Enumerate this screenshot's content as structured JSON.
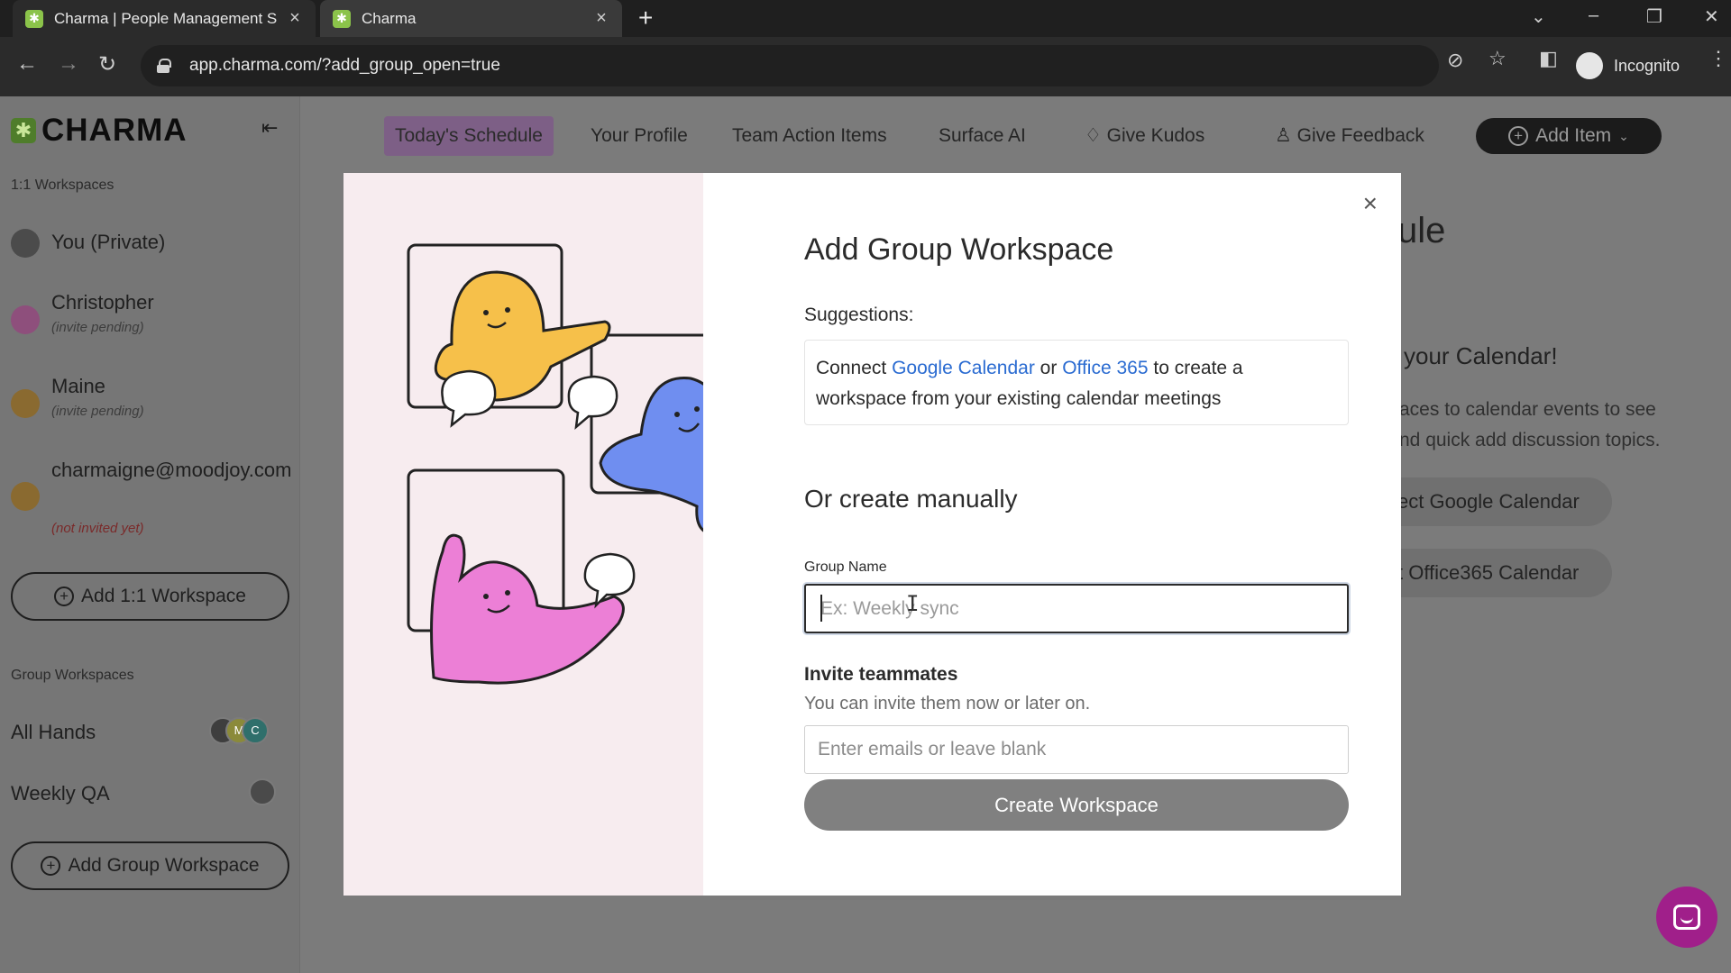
{
  "browser": {
    "tabs": [
      {
        "title": "Charma | People Management S",
        "active": false
      },
      {
        "title": "Charma",
        "active": true
      }
    ],
    "url": "app.charma.com/?add_group_open=true",
    "profile_label": "Incognito"
  },
  "sidebar": {
    "logo": "CHARMA",
    "one_on_one_label": "1:1 Workspaces",
    "people": [
      {
        "name": "You (Private)",
        "status": ""
      },
      {
        "name": "Christopher",
        "status": "(invite pending)"
      },
      {
        "name": "Maine",
        "status": "(invite pending)"
      },
      {
        "name": "charmaigne@moodjoy.com",
        "status": "(not invited yet)"
      }
    ],
    "add_one_on_one": "Add 1:1 Workspace",
    "group_label": "Group Workspaces",
    "groups": [
      {
        "name": "All Hands",
        "members": [
          "",
          "M",
          "C"
        ]
      },
      {
        "name": "Weekly QA",
        "members": [
          ""
        ]
      }
    ],
    "add_group": "Add Group Workspace"
  },
  "topnav": {
    "items": [
      "Today's Schedule",
      "Your Profile",
      "Team Action Items",
      "Surface AI",
      "Give Kudos",
      "Give Feedback"
    ],
    "add_item": "Add Item"
  },
  "background": {
    "title_fragment": "ule",
    "calendar_heading": "your Calendar!",
    "calendar_text_1": "aces to calendar events to see",
    "calendar_text_2": "nd quick add discussion topics.",
    "google_btn": "ect Google Calendar",
    "office_btn": "t Office365 Calendar"
  },
  "modal": {
    "title": "Add Group Workspace",
    "suggestions_label": "Suggestions:",
    "suggestion_prefix": "Connect ",
    "google_link": "Google Calendar",
    "or_word": " or ",
    "office_link": "Office 365",
    "suggestion_suffix": " to create a workspace from your existing calendar meetings",
    "or_create": "Or create manually",
    "group_name_label": "Group Name",
    "group_name_placeholder": "Ex: Weekly sync",
    "group_name_value": "",
    "invite_label": "Invite teammates",
    "invite_sub": "You can invite them now or later on.",
    "email_placeholder": "Enter emails or leave blank",
    "create_button": "Create Workspace",
    "close_label": "×"
  },
  "colors": {
    "accent_link": "#2a6bd1",
    "illustration_bg": "#f7ecef",
    "chat_launcher": "#a01f8a"
  }
}
